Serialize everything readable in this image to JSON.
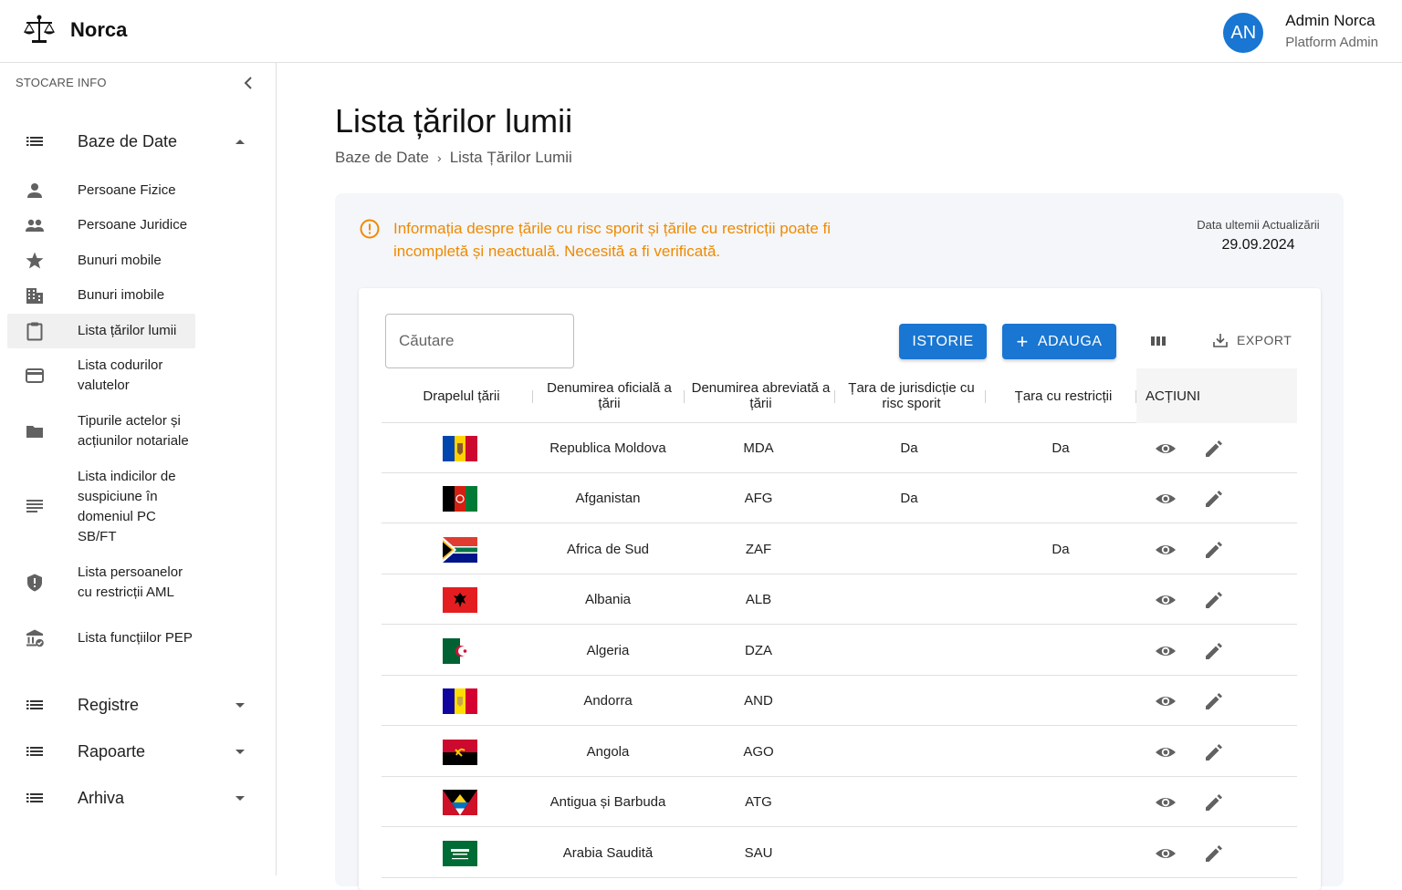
{
  "app": {
    "name": "Norca"
  },
  "user": {
    "initials": "AN",
    "name": "Admin Norca",
    "role": "Platform Admin"
  },
  "sidebar": {
    "header": "STOCARE INFO",
    "groups": {
      "baze": "Baze de Date",
      "registre": "Registre",
      "rapoarte": "Rapoarte",
      "arhiva": "Arhiva"
    },
    "items": [
      {
        "label": "Persoane Fizice"
      },
      {
        "label": "Persoane Juridice"
      },
      {
        "label": "Bunuri mobile"
      },
      {
        "label": "Bunuri imobile"
      },
      {
        "label": "Lista țărilor lumii"
      },
      {
        "label": "Lista codurilor valutelor"
      },
      {
        "label": "Tipurile actelor și acțiunilor notariale"
      },
      {
        "label": "Lista indicilor de suspiciune în domeniul PC SB/FT"
      },
      {
        "label": "Lista persoanelor cu restricții AML"
      },
      {
        "label": "Lista funcțiilor PEP"
      }
    ]
  },
  "page": {
    "title": "Lista țărilor lumii",
    "breadcrumb": [
      "Baze de Date",
      "›",
      "Lista Țărilor Lumii"
    ]
  },
  "alert": {
    "text": "Informația despre țările cu risc sporit și țările cu restricții poate fi incompletă și neactuală. Necesită a fi verificată."
  },
  "update": {
    "label": "Data ultemii Actualizării",
    "value": "29.09.2024"
  },
  "toolbar": {
    "search_placeholder": "Căutare",
    "istorie_label": "ISTORIE",
    "adauga_plus": "+",
    "adauga_label": "ADAUGA",
    "export_label": "EXPORT"
  },
  "table": {
    "headers": [
      "Drapelul țării",
      "Denumirea oficială a țării",
      "Denumirea abreviată a țării",
      "Țara de jurisdicție cu risc sporit",
      "Țara cu restricții",
      "ACȚIUNI"
    ],
    "rows": [
      {
        "flag": "moldova-flag",
        "name": "Republica Moldova",
        "code": "MDA",
        "risk": "Da",
        "restricted": "Da"
      },
      {
        "flag": "afghanistan-flag",
        "name": "Afganistan",
        "code": "AFG",
        "risk": "Da",
        "restricted": ""
      },
      {
        "flag": "south-africa-flag",
        "name": "Africa de Sud",
        "code": "ZAF",
        "risk": "",
        "restricted": "Da"
      },
      {
        "flag": "albania-flag",
        "name": "Albania",
        "code": "ALB",
        "risk": "",
        "restricted": ""
      },
      {
        "flag": "algeria-flag",
        "name": "Algeria",
        "code": "DZA",
        "risk": "",
        "restricted": ""
      },
      {
        "flag": "andorra-flag",
        "name": "Andorra",
        "code": "AND",
        "risk": "",
        "restricted": ""
      },
      {
        "flag": "angola-flag",
        "name": "Angola",
        "code": "AGO",
        "risk": "",
        "restricted": ""
      },
      {
        "flag": "antigua-barbuda-flag",
        "name": "Antigua și Barbuda",
        "code": "ATG",
        "risk": "",
        "restricted": ""
      },
      {
        "flag": "saudi-arabia-flag",
        "name": "Arabia Saudită",
        "code": "SAU",
        "risk": "",
        "restricted": ""
      }
    ]
  },
  "colors": {
    "primary": "#1976d2",
    "warning": "#ef8a00",
    "icon": "#616161"
  }
}
